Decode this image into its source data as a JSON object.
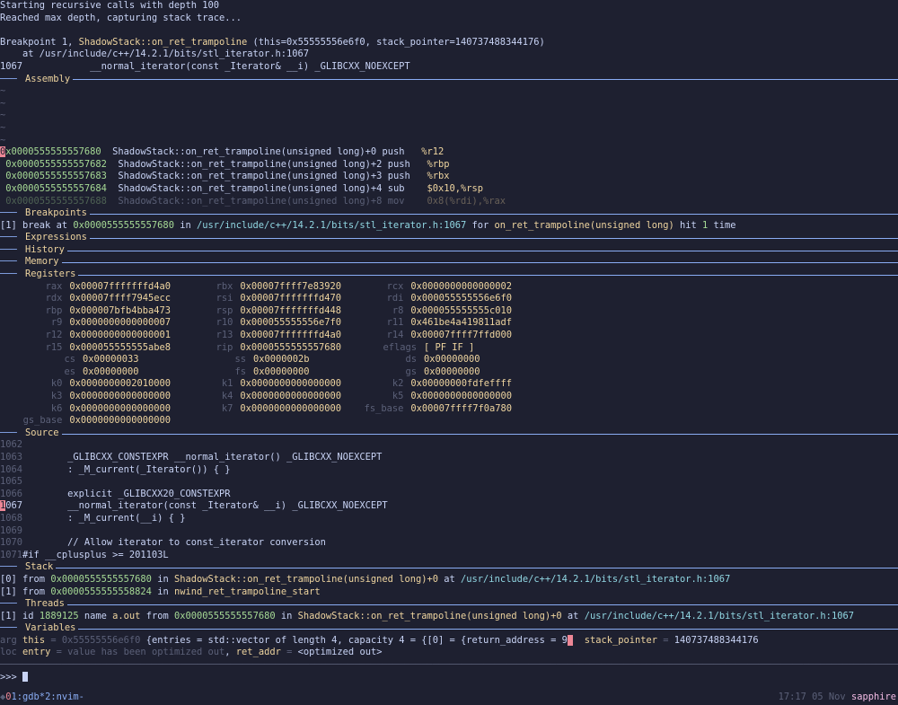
{
  "preamble": [
    "Starting recursive calls with depth 100",
    "Reached max depth, capturing stack trace..."
  ],
  "breakpoint_hit": {
    "prefix": "Breakpoint 1, ",
    "func": "ShadowStack::on_ret_trampoline",
    "args": " (this=0x55555556e6f0, stack_pointer=140737488344176)",
    "at_line": "    at /usr/include/c++/14.2.1/bits/stl_iterator.h:1067",
    "src_no": "1067",
    "src_text": "            __normal_iterator(const _Iterator& __i) _GLIBCXX_NOEXCEPT"
  },
  "sections": {
    "assembly": "Assembly",
    "breakpoints": "Breakpoints",
    "expressions": "Expressions",
    "history": "History",
    "memory": "Memory",
    "registers": "Registers",
    "source": "Source",
    "stack": "Stack",
    "threads": "Threads",
    "variables": "Variables"
  },
  "assembly": [
    {
      "addr": "0x0000555555557680",
      "sym": "ShadowStack::on_ret_trampoline(unsigned long)+0",
      "op": "push",
      "args": "%r12",
      "current": true
    },
    {
      "addr": "0x0000555555557682",
      "sym": "ShadowStack::on_ret_trampoline(unsigned long)+2",
      "op": "push",
      "args": "%rbp"
    },
    {
      "addr": "0x0000555555557683",
      "sym": "ShadowStack::on_ret_trampoline(unsigned long)+3",
      "op": "push",
      "args": "%rbx"
    },
    {
      "addr": "0x0000555555557684",
      "sym": "ShadowStack::on_ret_trampoline(unsigned long)+4",
      "op": "sub",
      "args": "$0x10,%rsp"
    },
    {
      "addr": "0x0000555555557688",
      "sym": "ShadowStack::on_ret_trampoline(unsigned long)+8",
      "op": "mov",
      "args": "0x8(%rdi),%rax"
    }
  ],
  "breakpoint_entry": {
    "idx": "[1]",
    "pre": " break at ",
    "addr": "0x0000555555557680",
    "in": " in ",
    "path": "/usr/include/c++/14.2.1/bits/stl_iterator.h:1067",
    "for": " for ",
    "func": "on_ret_trampoline(unsigned long)",
    "hit": " hit ",
    "count": "1",
    "time": " time"
  },
  "registers": [
    [
      {
        "n": "rax",
        "v": "0x00007fffffffd4a0"
      },
      {
        "n": "rbx",
        "v": "0x00007ffff7e83920"
      },
      {
        "n": "rcx",
        "v": "0x0000000000000002"
      }
    ],
    [
      {
        "n": "rdx",
        "v": "0x00007ffff7945ecc"
      },
      {
        "n": "rsi",
        "v": "0x00007fffffffd470"
      },
      {
        "n": "rdi",
        "v": "0x000055555556e6f0"
      }
    ],
    [
      {
        "n": "rbp",
        "v": "0x000007bfb4bba473"
      },
      {
        "n": "rsp",
        "v": "0x00007fffffffd448"
      },
      {
        "n": "r8",
        "v": "0x000055555555c010"
      }
    ],
    [
      {
        "n": "r9",
        "v": "0x0000000000000007"
      },
      {
        "n": "r10",
        "v": "0x000055555556e7f0"
      },
      {
        "n": "r11",
        "v": "0x461be4a419811adf"
      }
    ],
    [
      {
        "n": "r12",
        "v": "0x0000000000000001"
      },
      {
        "n": "r13",
        "v": "0x00007fffffffd4a0"
      },
      {
        "n": "r14",
        "v": "0x00007ffff7ffd000"
      }
    ],
    [
      {
        "n": "r15",
        "v": "0x000055555555abe8"
      },
      {
        "n": "rip",
        "v": "0x0000555555557680"
      },
      {
        "n": "eflags",
        "v": "[ PF IF ]"
      }
    ],
    [
      {
        "n": "cs",
        "v": "0x00000033"
      },
      {
        "n": "ss",
        "v": "0x0000002b"
      },
      {
        "n": "ds",
        "v": "0x00000000"
      }
    ],
    [
      {
        "n": "es",
        "v": "0x00000000"
      },
      {
        "n": "fs",
        "v": "0x00000000"
      },
      {
        "n": "gs",
        "v": "0x00000000"
      }
    ],
    [
      {
        "n": "k0",
        "v": "0x0000000002010000"
      },
      {
        "n": "k1",
        "v": "0x0000000000000000"
      },
      {
        "n": "k2",
        "v": "0x00000000fdfeffff"
      }
    ],
    [
      {
        "n": "k3",
        "v": "0x0000000000000000"
      },
      {
        "n": "k4",
        "v": "0x0000000000000000"
      },
      {
        "n": "k5",
        "v": "0x0000000000000000"
      }
    ],
    [
      {
        "n": "k6",
        "v": "0x0000000000000000"
      },
      {
        "n": "k7",
        "v": "0x0000000000000000"
      },
      {
        "n": "fs_base",
        "v": "0x00007ffff7f0a780"
      }
    ],
    [
      {
        "n": "gs_base",
        "v": "0x0000000000000000"
      }
    ]
  ],
  "source": [
    {
      "no": "1062",
      "text": ""
    },
    {
      "no": "1063",
      "text": "        _GLIBCXX_CONSTEXPR __normal_iterator() _GLIBCXX_NOEXCEPT"
    },
    {
      "no": "1064",
      "text": "        : _M_current(_Iterator()) { }"
    },
    {
      "no": "1065",
      "text": ""
    },
    {
      "no": "1066",
      "text": "        explicit _GLIBCXX20_CONSTEXPR"
    },
    {
      "no": "1067",
      "text": "        __normal_iterator(const _Iterator& __i) _GLIBCXX_NOEXCEPT",
      "current": true
    },
    {
      "no": "1068",
      "text": "        : _M_current(__i) { }"
    },
    {
      "no": "1069",
      "text": ""
    },
    {
      "no": "1070",
      "text": "        // Allow iterator to const_iterator conversion"
    },
    {
      "no": "1071",
      "text": "#if __cplusplus >= 201103L"
    }
  ],
  "stack": [
    {
      "idx": "[0]",
      "from": " from ",
      "addr": "0x0000555555557680",
      "in": " in ",
      "func": "ShadowStack::on_ret_trampoline(unsigned long)+0",
      "at": " at ",
      "path": "/usr/include/c++/14.2.1/bits/stl_iterator.h:1067"
    },
    {
      "idx": "[1]",
      "from": " from ",
      "addr": "0x0000555555558824",
      "in": " in ",
      "func": "nwind_ret_trampoline_start",
      "at": "",
      "path": ""
    }
  ],
  "thread": {
    "idx": "[1]",
    "id": " id ",
    "tid": "1889125",
    "name": " name ",
    "tname": "a.out",
    "from": " from ",
    "addr": "0x0000555555557680",
    "in": " in ",
    "func": "ShadowStack::on_ret_trampoline(unsigned long)+0",
    "at": " at ",
    "path": "/usr/include/c++/14.2.1/bits/stl_iterator.h:1067"
  },
  "variables": {
    "arg_label": "arg",
    "this_name": "this",
    "this_eq": " = ",
    "this_addr": "0x55555556e6f0",
    "this_val": "{entries = std::vector of length 4, capacity 4 = {[0] = {return_address = 9",
    "sp_name": "stack_pointer",
    "sp_eq": " = ",
    "sp_val": "140737488344176",
    "loc_label": "loc",
    "entry_name": "entry",
    "entry_eq": " = ",
    "entry_val": "value has been optimized out",
    "retaddr_name": "ret_addr",
    "retaddr_eq": " = ",
    "retaddr_val": "<optimized out>"
  },
  "prompt": ">>> ",
  "status": {
    "session": "0",
    "win1": "1:gdb*",
    "win2": "2:nvim-",
    "time": "17:17",
    "date": "05 Nov",
    "host": "sapphire"
  }
}
